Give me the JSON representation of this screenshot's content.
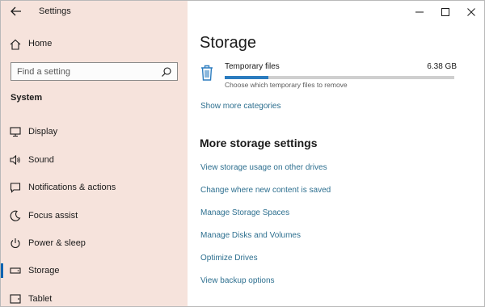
{
  "window": {
    "app_title": "Settings",
    "controls": [
      "minimize",
      "maximize",
      "close"
    ]
  },
  "sidebar": {
    "home_label": "Home",
    "search_placeholder": "Find a setting",
    "section_heading": "System",
    "items": [
      {
        "label": "Display",
        "icon": "display-icon",
        "selected": false
      },
      {
        "label": "Sound",
        "icon": "speaker-icon",
        "selected": false
      },
      {
        "label": "Notifications & actions",
        "icon": "notification-icon",
        "selected": false
      },
      {
        "label": "Focus assist",
        "icon": "moon-icon",
        "selected": false
      },
      {
        "label": "Power & sleep",
        "icon": "power-icon",
        "selected": false
      },
      {
        "label": "Storage",
        "icon": "storage-icon",
        "selected": true
      },
      {
        "label": "Tablet",
        "icon": "tablet-icon",
        "selected": false
      }
    ]
  },
  "main": {
    "title": "Storage",
    "temp_files": {
      "label": "Temporary files",
      "size": "6.38 GB",
      "description": "Choose which temporary files to remove",
      "usage_fraction": 0.19
    },
    "show_more": "Show more categories",
    "more_settings_title": "More storage settings",
    "links": [
      "View storage usage on other drives",
      "Change where new content is saved",
      "Manage Storage Spaces",
      "Manage Disks and Volumes",
      "Optimize Drives",
      "View backup options"
    ]
  },
  "colors": {
    "sidebar_bg": "#f6e3dc",
    "accent": "#0063b1",
    "link": "#2d6f8f",
    "progress_fill": "#2b7cbf"
  }
}
